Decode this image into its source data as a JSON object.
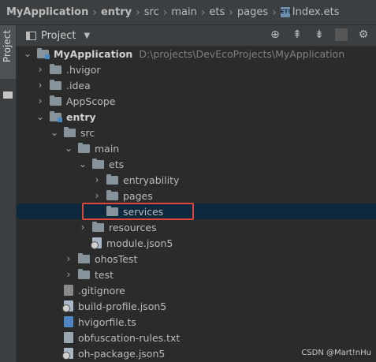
{
  "breadcrumb": {
    "items": [
      "MyApplication",
      "entry",
      "src",
      "main",
      "ets",
      "pages",
      "Index.ets"
    ],
    "file_badge": "ETS"
  },
  "side_tab": {
    "label": "Project"
  },
  "panel": {
    "title": "Project"
  },
  "tree": [
    {
      "label": "MyApplication",
      "path": "D:\\projects\\DevEcoProjects\\MyApplication"
    },
    {
      "label": ".hvigor"
    },
    {
      "label": ".idea"
    },
    {
      "label": "AppScope"
    },
    {
      "label": "entry"
    },
    {
      "label": "src"
    },
    {
      "label": "main"
    },
    {
      "label": "ets"
    },
    {
      "label": "entryability"
    },
    {
      "label": "pages"
    },
    {
      "label": "services"
    },
    {
      "label": "resources"
    },
    {
      "label": "module.json5"
    },
    {
      "label": "ohosTest"
    },
    {
      "label": "test"
    },
    {
      "label": ".gitignore"
    },
    {
      "label": "build-profile.json5"
    },
    {
      "label": "hvigorfile.ts"
    },
    {
      "label": "obfuscation-rules.txt"
    },
    {
      "label": "oh-package.json5"
    }
  ],
  "watermark": "CSDN @Mart!nHu",
  "colors": {
    "selection": "#0d293e",
    "highlight_border": "#e0453b"
  }
}
